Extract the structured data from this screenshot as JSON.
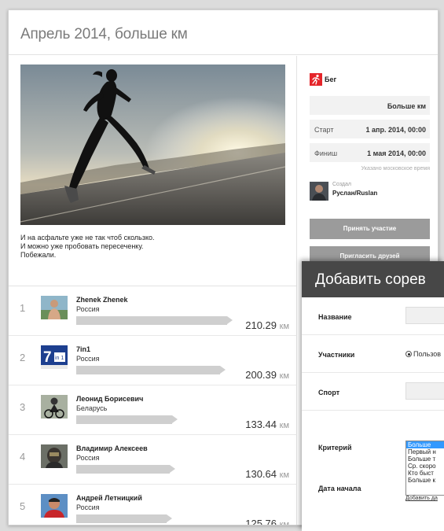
{
  "page": {
    "title": "Апрель 2014, больше км"
  },
  "event": {
    "description_lines": [
      "И на асфальте уже не так чтоб скользко.",
      "И можно уже пробовать пересеченку.",
      "Побежали."
    ],
    "photo_icon": "runner-photo"
  },
  "ranking": [
    {
      "pos": "1",
      "name": "Zhenek Zhenek",
      "country": "Россия",
      "distance": "210.29",
      "unit": "км",
      "fraction": 1.0,
      "avatar": "avatar-shirtless"
    },
    {
      "pos": "2",
      "name": "7in1",
      "country": "Россия",
      "distance": "200.39",
      "unit": "км",
      "fraction": 0.953,
      "avatar": "avatar-7in1-sign"
    },
    {
      "pos": "3",
      "name": "Леонид Борисевич",
      "country": "Беларусь",
      "distance": "133.44",
      "unit": "км",
      "fraction": 0.635,
      "avatar": "avatar-cyclist"
    },
    {
      "pos": "4",
      "name": "Владимир Алексеев",
      "country": "Россия",
      "distance": "130.64",
      "unit": "км",
      "fraction": 0.621,
      "avatar": "avatar-helmet"
    },
    {
      "pos": "5",
      "name": "Андрей Летницкий",
      "country": "Россия",
      "distance": "125.76",
      "unit": "км",
      "fraction": 0.598,
      "avatar": "avatar-red-jacket"
    }
  ],
  "avatar_text": {
    "sign_number": "7",
    "sign_small": "in 1"
  },
  "sidebar": {
    "sport": "Бег",
    "sport_icon": "running-icon",
    "criterion": "Больше км",
    "start_label": "Старт",
    "start_value": "1 апр. 2014, 00:00",
    "finish_label": "Финиш",
    "finish_value": "1 мая 2014, 00:00",
    "tz_note": "Указано московское время",
    "creator_label": "Создал",
    "creator_name": "Руслан/Ruslan",
    "join_button": "Принять участие",
    "invite_button": "Пригласить друзей"
  },
  "dialog": {
    "title": "Добавить сорев",
    "name_label": "Название",
    "participants_label": "Участники",
    "participants_option": "Пользов",
    "sport_label": "Спорт",
    "criterion_label": "Критерий",
    "start_date_label": "Дата начала",
    "criterion_options": [
      "Больше",
      "Первый н",
      "Больше т",
      "Ср. скоро",
      "Кто быст",
      "Больше к"
    ],
    "selected_index": 0,
    "add_link": "Добавить да"
  },
  "colors": {
    "accent_red": "#e5252a",
    "button_gray": "#9b9b9b",
    "dialog_header": "#474747",
    "select_blue": "#3399ff"
  }
}
